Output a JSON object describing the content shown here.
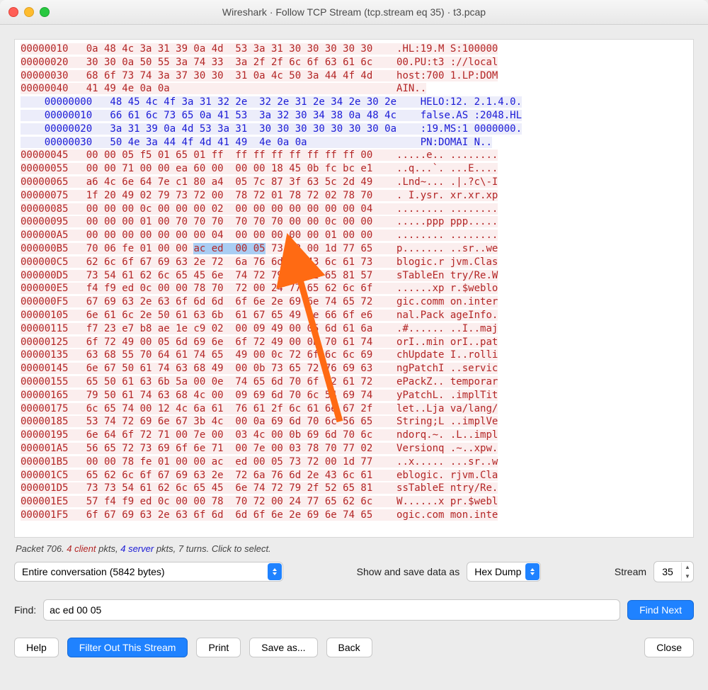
{
  "window": {
    "title": "Wireshark · Follow TCP Stream (tcp.stream eq 35) · t3.pcap"
  },
  "hex": {
    "client_top": [
      {
        "o": "00000010",
        "h": "0a 48 4c 3a 31 39 0a 4d  53 3a 31 30 30 30 30 30",
        "a": ".HL:19.M S:100000"
      },
      {
        "o": "00000020",
        "h": "30 30 0a 50 55 3a 74 33  3a 2f 2f 6c 6f 63 61 6c",
        "a": "00.PU:t3 ://local"
      },
      {
        "o": "00000030",
        "h": "68 6f 73 74 3a 37 30 30  31 0a 4c 50 3a 44 4f 4d",
        "a": "host:700 1.LP:DOM"
      },
      {
        "o": "00000040",
        "h": "41 49 4e 0a 0a",
        "a": "AIN.."
      }
    ],
    "server": [
      {
        "o": "00000000",
        "h": "48 45 4c 4f 3a 31 32 2e  32 2e 31 2e 34 2e 30 2e",
        "a": "HELO:12. 2.1.4.0."
      },
      {
        "o": "00000010",
        "h": "66 61 6c 73 65 0a 41 53  3a 32 30 34 38 0a 48 4c",
        "a": "false.AS :2048.HL"
      },
      {
        "o": "00000020",
        "h": "3a 31 39 0a 4d 53 3a 31  30 30 30 30 30 30 30 0a",
        "a": ":19.MS:1 0000000."
      },
      {
        "o": "00000030",
        "h": "50 4e 3a 44 4f 4d 41 49  4e 0a 0a",
        "a": "PN:DOMAI N.."
      }
    ],
    "client_main": [
      {
        "o": "00000045",
        "h": "00 00 05 f5 01 65 01 ff  ff ff ff ff ff ff ff 00",
        "a": ".....e.. ........"
      },
      {
        "o": "00000055",
        "h": "00 00 71 00 00 ea 60 00  00 00 18 45 0b fc bc e1",
        "a": "..q...`. ...E...."
      },
      {
        "o": "00000065",
        "h": "a6 4c 6e 64 7e c1 80 a4  05 7c 87 3f 63 5c 2d 49",
        "a": ".Lnd~... .|.?c\\-I"
      },
      {
        "o": "00000075",
        "h": "1f 20 49 02 79 73 72 00  78 72 01 78 72 02 78 70",
        "a": ". I.ysr. xr.xr.xp"
      },
      {
        "o": "00000085",
        "h": "00 00 00 0c 00 00 00 02  00 00 00 00 00 00 00 04",
        "a": "........ ........"
      },
      {
        "o": "00000095",
        "h": "00 00 00 01 00 70 70 70  70 70 70 00 00 0c 00 00",
        "a": ".....ppp ppp....."
      },
      {
        "o": "000000A5",
        "h": "00 00 00 00 00 00 00 04  00 00 00 00 00 01 00 00",
        "a": "........ ........"
      },
      {
        "o": "000000B5",
        "h_pre": "70 06 fe 01 00 00 ",
        "hl": "ac ed  00 05",
        "h_post": " 73 72 00 1d 77 65",
        "a": "p....... ..sr..we"
      },
      {
        "o": "000000C5",
        "h": "62 6c 6f 67 69 63 2e 72  6a 76 6d 2e 43 6c 61 73",
        "a": "blogic.r jvm.Clas"
      },
      {
        "o": "000000D5",
        "h": "73 54 61 62 6c 65 45 6e  74 72 79 2f 52 65 81 57",
        "a": "sTableEn try/Re.W"
      },
      {
        "o": "000000E5",
        "h": "f4 f9 ed 0c 00 00 78 70  72 00 24 77 65 62 6c 6f",
        "a": "......xp r.$weblo"
      },
      {
        "o": "000000F5",
        "h": "67 69 63 2e 63 6f 6d 6d  6f 6e 2e 69 6e 74 65 72",
        "a": "gic.comm on.inter"
      },
      {
        "o": "00000105",
        "h": "6e 61 6c 2e 50 61 63 6b  61 67 65 49 6e 66 6f e6",
        "a": "nal.Pack ageInfo."
      },
      {
        "o": "00000115",
        "h": "f7 23 e7 b8 ae 1e c9 02  00 09 49 00 05 6d 61 6a",
        "a": ".#...... ..I..maj"
      },
      {
        "o": "00000125",
        "h": "6f 72 49 00 05 6d 69 6e  6f 72 49 00 0b 70 61 74",
        "a": "orI..min orI..pat"
      },
      {
        "o": "00000135",
        "h": "63 68 55 70 64 61 74 65  49 00 0c 72 6f 6c 6c 69",
        "a": "chUpdate I..rolli"
      },
      {
        "o": "00000145",
        "h": "6e 67 50 61 74 63 68 49  00 0b 73 65 72 76 69 63",
        "a": "ngPatchI ..servic"
      },
      {
        "o": "00000155",
        "h": "65 50 61 63 6b 5a 00 0e  74 65 6d 70 6f 72 61 72",
        "a": "ePackZ.. temporar"
      },
      {
        "o": "00000165",
        "h": "79 50 61 74 63 68 4c 00  09 69 6d 70 6c 54 69 74",
        "a": "yPatchL. .implTit"
      },
      {
        "o": "00000175",
        "h": "6c 65 74 00 12 4c 6a 61  76 61 2f 6c 61 6e 67 2f",
        "a": "let..Lja va/lang/"
      },
      {
        "o": "00000185",
        "h": "53 74 72 69 6e 67 3b 4c  00 0a 69 6d 70 6c 56 65",
        "a": "String;L ..implVe"
      },
      {
        "o": "00000195",
        "h": "6e 64 6f 72 71 00 7e 00  03 4c 00 0b 69 6d 70 6c",
        "a": "ndorq.~. .L..impl"
      },
      {
        "o": "000001A5",
        "h": "56 65 72 73 69 6f 6e 71  00 7e 00 03 78 70 77 02",
        "a": "Versionq .~..xpw."
      },
      {
        "o": "000001B5",
        "h": "00 00 78 fe 01 00 00 ac  ed 00 05 73 72 00 1d 77",
        "a": "..x..... ...sr..w"
      },
      {
        "o": "000001C5",
        "h": "65 62 6c 6f 67 69 63 2e  72 6a 76 6d 2e 43 6c 61",
        "a": "eblogic. rjvm.Cla"
      },
      {
        "o": "000001D5",
        "h": "73 73 54 61 62 6c 65 45  6e 74 72 79 2f 52 65 81",
        "a": "ssTableE ntry/Re."
      },
      {
        "o": "000001E5",
        "h": "57 f4 f9 ed 0c 00 00 78  70 72 00 24 77 65 62 6c",
        "a": "W......x pr.$webl"
      },
      {
        "o": "000001F5",
        "h": "6f 67 69 63 2e 63 6f 6d  6d 6f 6e 2e 69 6e 74 65",
        "a": "ogic.com mon.inte"
      }
    ]
  },
  "status": {
    "packet": "Packet 706.",
    "client_n": "4",
    "client_w": "client",
    "pkts1": "pkts,",
    "server_n": "4",
    "server_w": "server",
    "tail": "pkts, 7 turns. Click to select."
  },
  "controls": {
    "conversation": "Entire conversation (5842 bytes)",
    "show_label": "Show and save data as",
    "format": "Hex Dump",
    "stream_label": "Stream",
    "stream_value": "35"
  },
  "find": {
    "label": "Find:",
    "value": "ac ed 00 05",
    "button": "Find Next"
  },
  "buttons": {
    "help": "Help",
    "filter": "Filter Out This Stream",
    "print": "Print",
    "save": "Save as...",
    "back": "Back",
    "close": "Close"
  }
}
